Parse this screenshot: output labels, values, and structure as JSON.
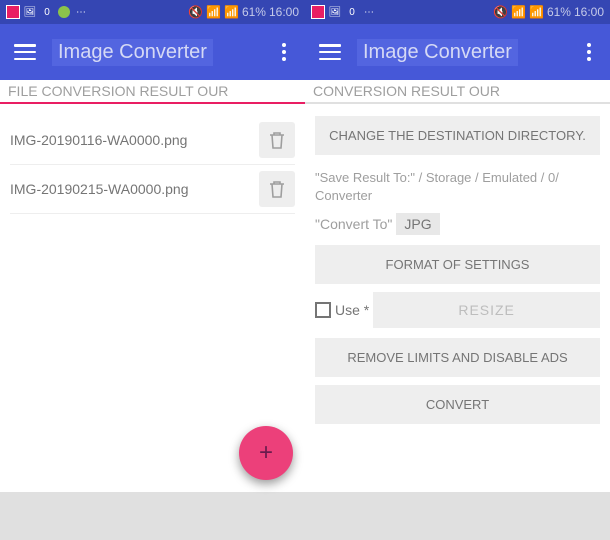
{
  "status": {
    "battery": "61%",
    "time": "16:00",
    "notif3": "0"
  },
  "app": {
    "title": "Image Converter"
  },
  "left": {
    "section_header": "FILE CONVERSION RESULT OUR",
    "files": [
      {
        "name": "IMG-20190116-WA0000.png"
      },
      {
        "name": "IMG-20190215-WA0000.png"
      }
    ]
  },
  "right": {
    "section_header": "CONVERSION RESULT OUR",
    "change_dest": "CHANGE THE DESTINATION DIRECTORY.",
    "save_result": "\"Save Result To:\" / Storage / Emulated / 0/ Converter",
    "convert_to_label": "\"Convert To\"",
    "convert_to_value": "JPG",
    "format_settings": "FORMAT OF SETTINGS",
    "use_label": "Use *",
    "resize": "RESIZE",
    "remove_limits": "REMOVE LIMITS AND DISABLE ADS",
    "convert": "CONVERT"
  }
}
